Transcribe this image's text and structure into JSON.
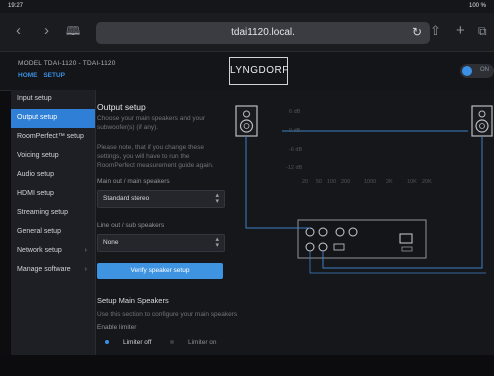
{
  "status": {
    "time": "19:27",
    "battery": "100 %"
  },
  "browser": {
    "url": "tdai1120.local."
  },
  "header": {
    "model": "MODEL TDAI-1120 - TDAI-1120",
    "breadcrumb": [
      "HOME",
      "SETUP"
    ],
    "logo": "LYNGDORF",
    "power_label": "ON"
  },
  "sidebar": {
    "items": [
      {
        "label": "Input setup",
        "chevron": ""
      },
      {
        "label": "Output setup",
        "chevron": ""
      },
      {
        "label": "RoomPerfect™ setup",
        "chevron": ""
      },
      {
        "label": "Voicing setup",
        "chevron": ""
      },
      {
        "label": "Audio setup",
        "chevron": ""
      },
      {
        "label": "HDMI setup",
        "chevron": ""
      },
      {
        "label": "Streaming setup",
        "chevron": ""
      },
      {
        "label": "General setup",
        "chevron": ""
      },
      {
        "label": "Network setup",
        "chevron": "›"
      },
      {
        "label": "Manage software",
        "chevron": "›"
      }
    ],
    "active_index": 1
  },
  "output": {
    "title": "Output setup",
    "description": "Choose your main speakers and your subwoofer(s) (if any).",
    "notice": "Please note, that if you change these settings, you will have to run the RoomPerfect measurement guide again.",
    "main_label": "Main out / main speakers",
    "main_value": "Standard stereo",
    "sub_label": "Line out / sub speakers",
    "sub_value": "None",
    "verify_button": "Verify speaker setup",
    "setup_title": "Setup Main Speakers",
    "setup_desc": "Use this section to configure your main speakers",
    "limiter_label": "Enable limiter",
    "limiter_options": [
      {
        "label": "Limiter off",
        "selected": true
      },
      {
        "label": "Limiter on",
        "selected": false
      }
    ]
  },
  "graph": {
    "db_labels": [
      "6 dB",
      "0 dB",
      "-6 dB",
      "-12 dB"
    ],
    "freq_labels": [
      "20",
      "50",
      "100",
      "200",
      "500",
      "1000",
      "2K",
      "5K",
      "10K",
      "20K"
    ]
  }
}
